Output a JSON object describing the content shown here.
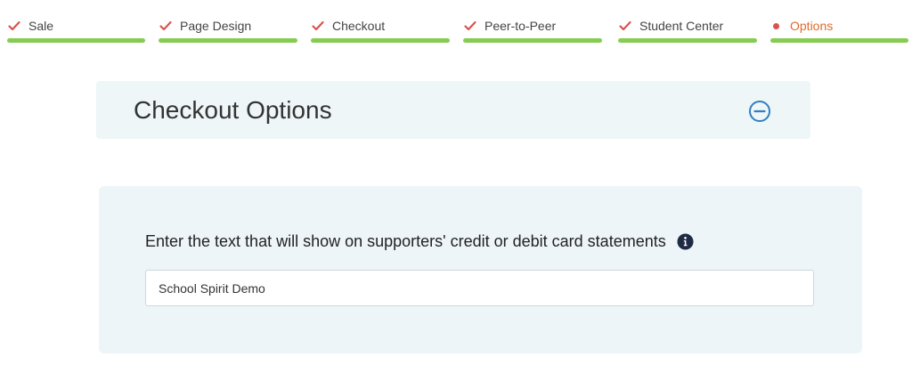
{
  "stepper": {
    "steps": [
      {
        "label": "Sale",
        "state": "complete"
      },
      {
        "label": "Page Design",
        "state": "complete"
      },
      {
        "label": "Checkout",
        "state": "complete"
      },
      {
        "label": "Peer-to-Peer",
        "state": "complete"
      },
      {
        "label": "Student Center",
        "state": "complete"
      },
      {
        "label": "Options",
        "state": "active"
      }
    ]
  },
  "section": {
    "title": "Checkout Options",
    "collapse_icon": "minus-circle-icon"
  },
  "statement_field": {
    "label": "Enter the text that will show on supporters' credit or debit card statements",
    "info_icon": "info-circle-icon",
    "value": "School Spirit Demo",
    "placeholder": ""
  },
  "colors": {
    "step_bar": "#86cc52",
    "check": "#d9534f",
    "active_dot": "#d9534f",
    "active_label": "#e06a2c",
    "header_bg": "#eef6f8",
    "panel_bg": "#eef5f8",
    "collapse_icon": "#2f7fc1",
    "info_icon": "#1f2a44"
  }
}
